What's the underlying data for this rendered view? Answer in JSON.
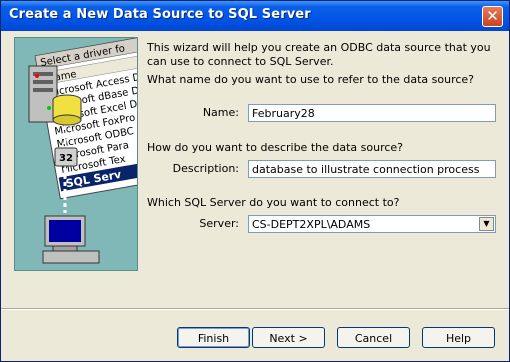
{
  "window": {
    "title": "Create a New Data Source to SQL Server"
  },
  "intro": "This wizard will help you create an ODBC data source that you can use to connect to SQL Server.",
  "q_name": "What name do you want to use to refer to the data source?",
  "name_label": "Name:",
  "name_value": "February28",
  "q_desc": "How do you want to describe the data source?",
  "desc_label": "Description:",
  "desc_value": "database to illustrate connection process",
  "q_server": "Which SQL Server do you want to connect to?",
  "server_label": "Server:",
  "server_value": "CS-DEPT2XPL\\ADAMS",
  "buttons": {
    "finish": "Finish",
    "next": "Next >",
    "cancel": "Cancel",
    "help": "Help"
  },
  "art": {
    "header": "Select a driver fo",
    "col": "Name",
    "drivers": [
      "Microsoft Access D",
      "Microsoft dBase D",
      "Microsoft Excel Dr",
      "Microsoft FoxPro",
      "Microsoft ODBC",
      "Microsoft Para",
      "Microsoft Tex",
      "SQL Serv"
    ],
    "badge": "32"
  }
}
